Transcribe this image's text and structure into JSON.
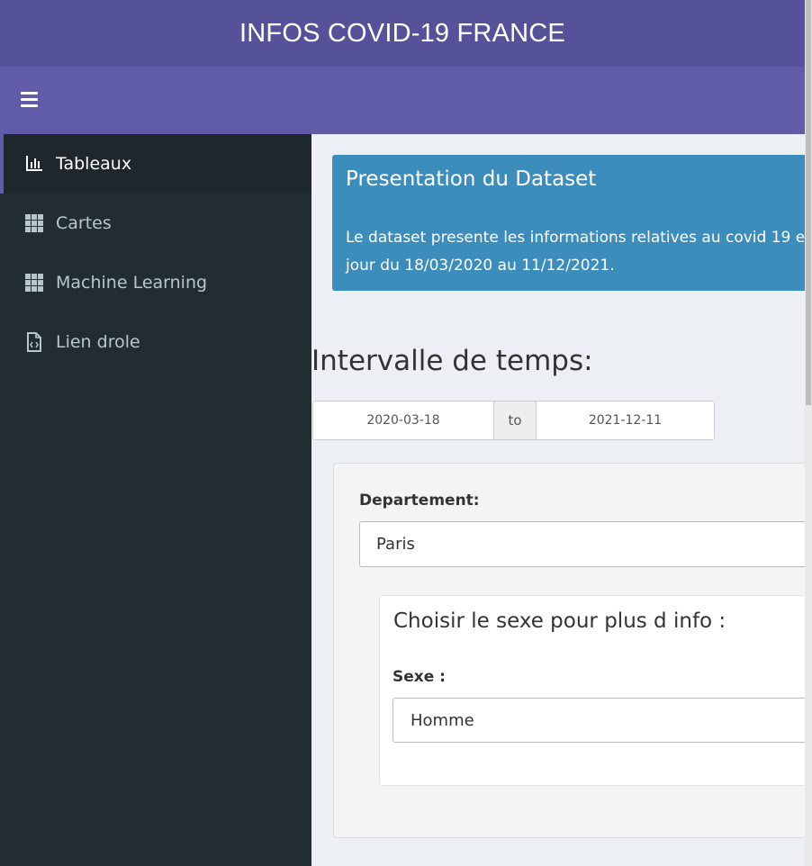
{
  "header": {
    "title": "INFOS COVID-19 FRANCE"
  },
  "navbar": {
    "toggle_icon": "bars-icon"
  },
  "sidebar": {
    "items": [
      {
        "label": "Tableaux",
        "icon": "bar-chart-icon",
        "active": true
      },
      {
        "label": "Cartes",
        "icon": "grid-icon",
        "active": false
      },
      {
        "label": "Machine Learning",
        "icon": "grid-icon",
        "active": false
      },
      {
        "label": "Lien drole",
        "icon": "file-code-icon",
        "active": false
      }
    ]
  },
  "info_box": {
    "title": "Presentation du Dataset",
    "line1": "Le dataset presente les informations relatives au covid 19 e",
    "line2": "jour du 18/03/2020 au 11/12/2021."
  },
  "date_section": {
    "heading": "Intervalle de temps:",
    "start": "2020-03-18",
    "separator": "to",
    "end": "2021-12-11"
  },
  "filters": {
    "departement_label": "Departement:",
    "departement_value": "Paris",
    "sex_panel_heading": "Choisir le sexe pour plus d info :",
    "sexe_label": "Sexe :",
    "sexe_value": "Homme"
  },
  "colors": {
    "title_bar": "#555299",
    "navbar": "#605ca8",
    "sidebar": "#222d32",
    "info_box": "#3c8dbc",
    "content_bg": "#ecf0f5"
  }
}
